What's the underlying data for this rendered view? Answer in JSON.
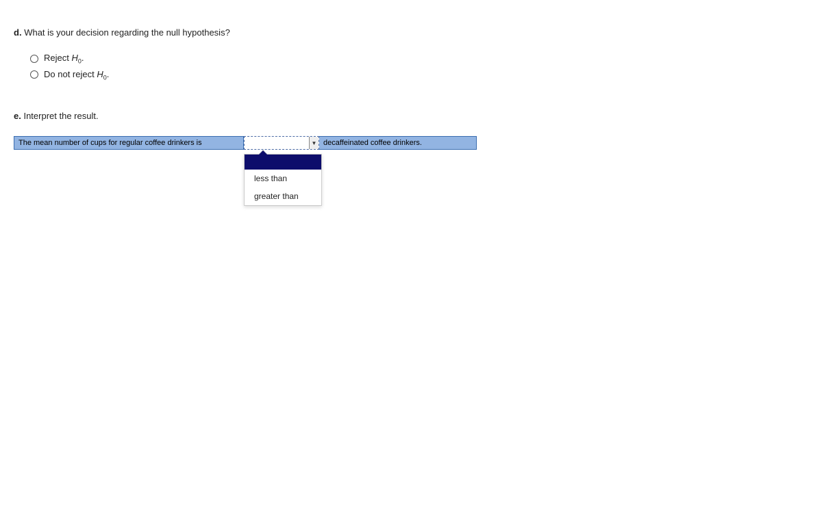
{
  "question_d": {
    "label": "d.",
    "text": "What is your decision regarding the null hypothesis?",
    "options": [
      {
        "prefix": "Reject ",
        "var": "H",
        "sub": "0",
        "suffix": "."
      },
      {
        "prefix": "Do not reject ",
        "var": "H",
        "sub": "0",
        "suffix": "."
      }
    ]
  },
  "question_e": {
    "label": "e.",
    "text": "Interpret the result.",
    "sentence_left": "The mean number of cups for regular coffee drinkers is",
    "sentence_right": "decaffeinated coffee drinkers.",
    "dropdown": {
      "selected": "",
      "options": [
        "",
        "less than",
        "greater than"
      ]
    }
  }
}
